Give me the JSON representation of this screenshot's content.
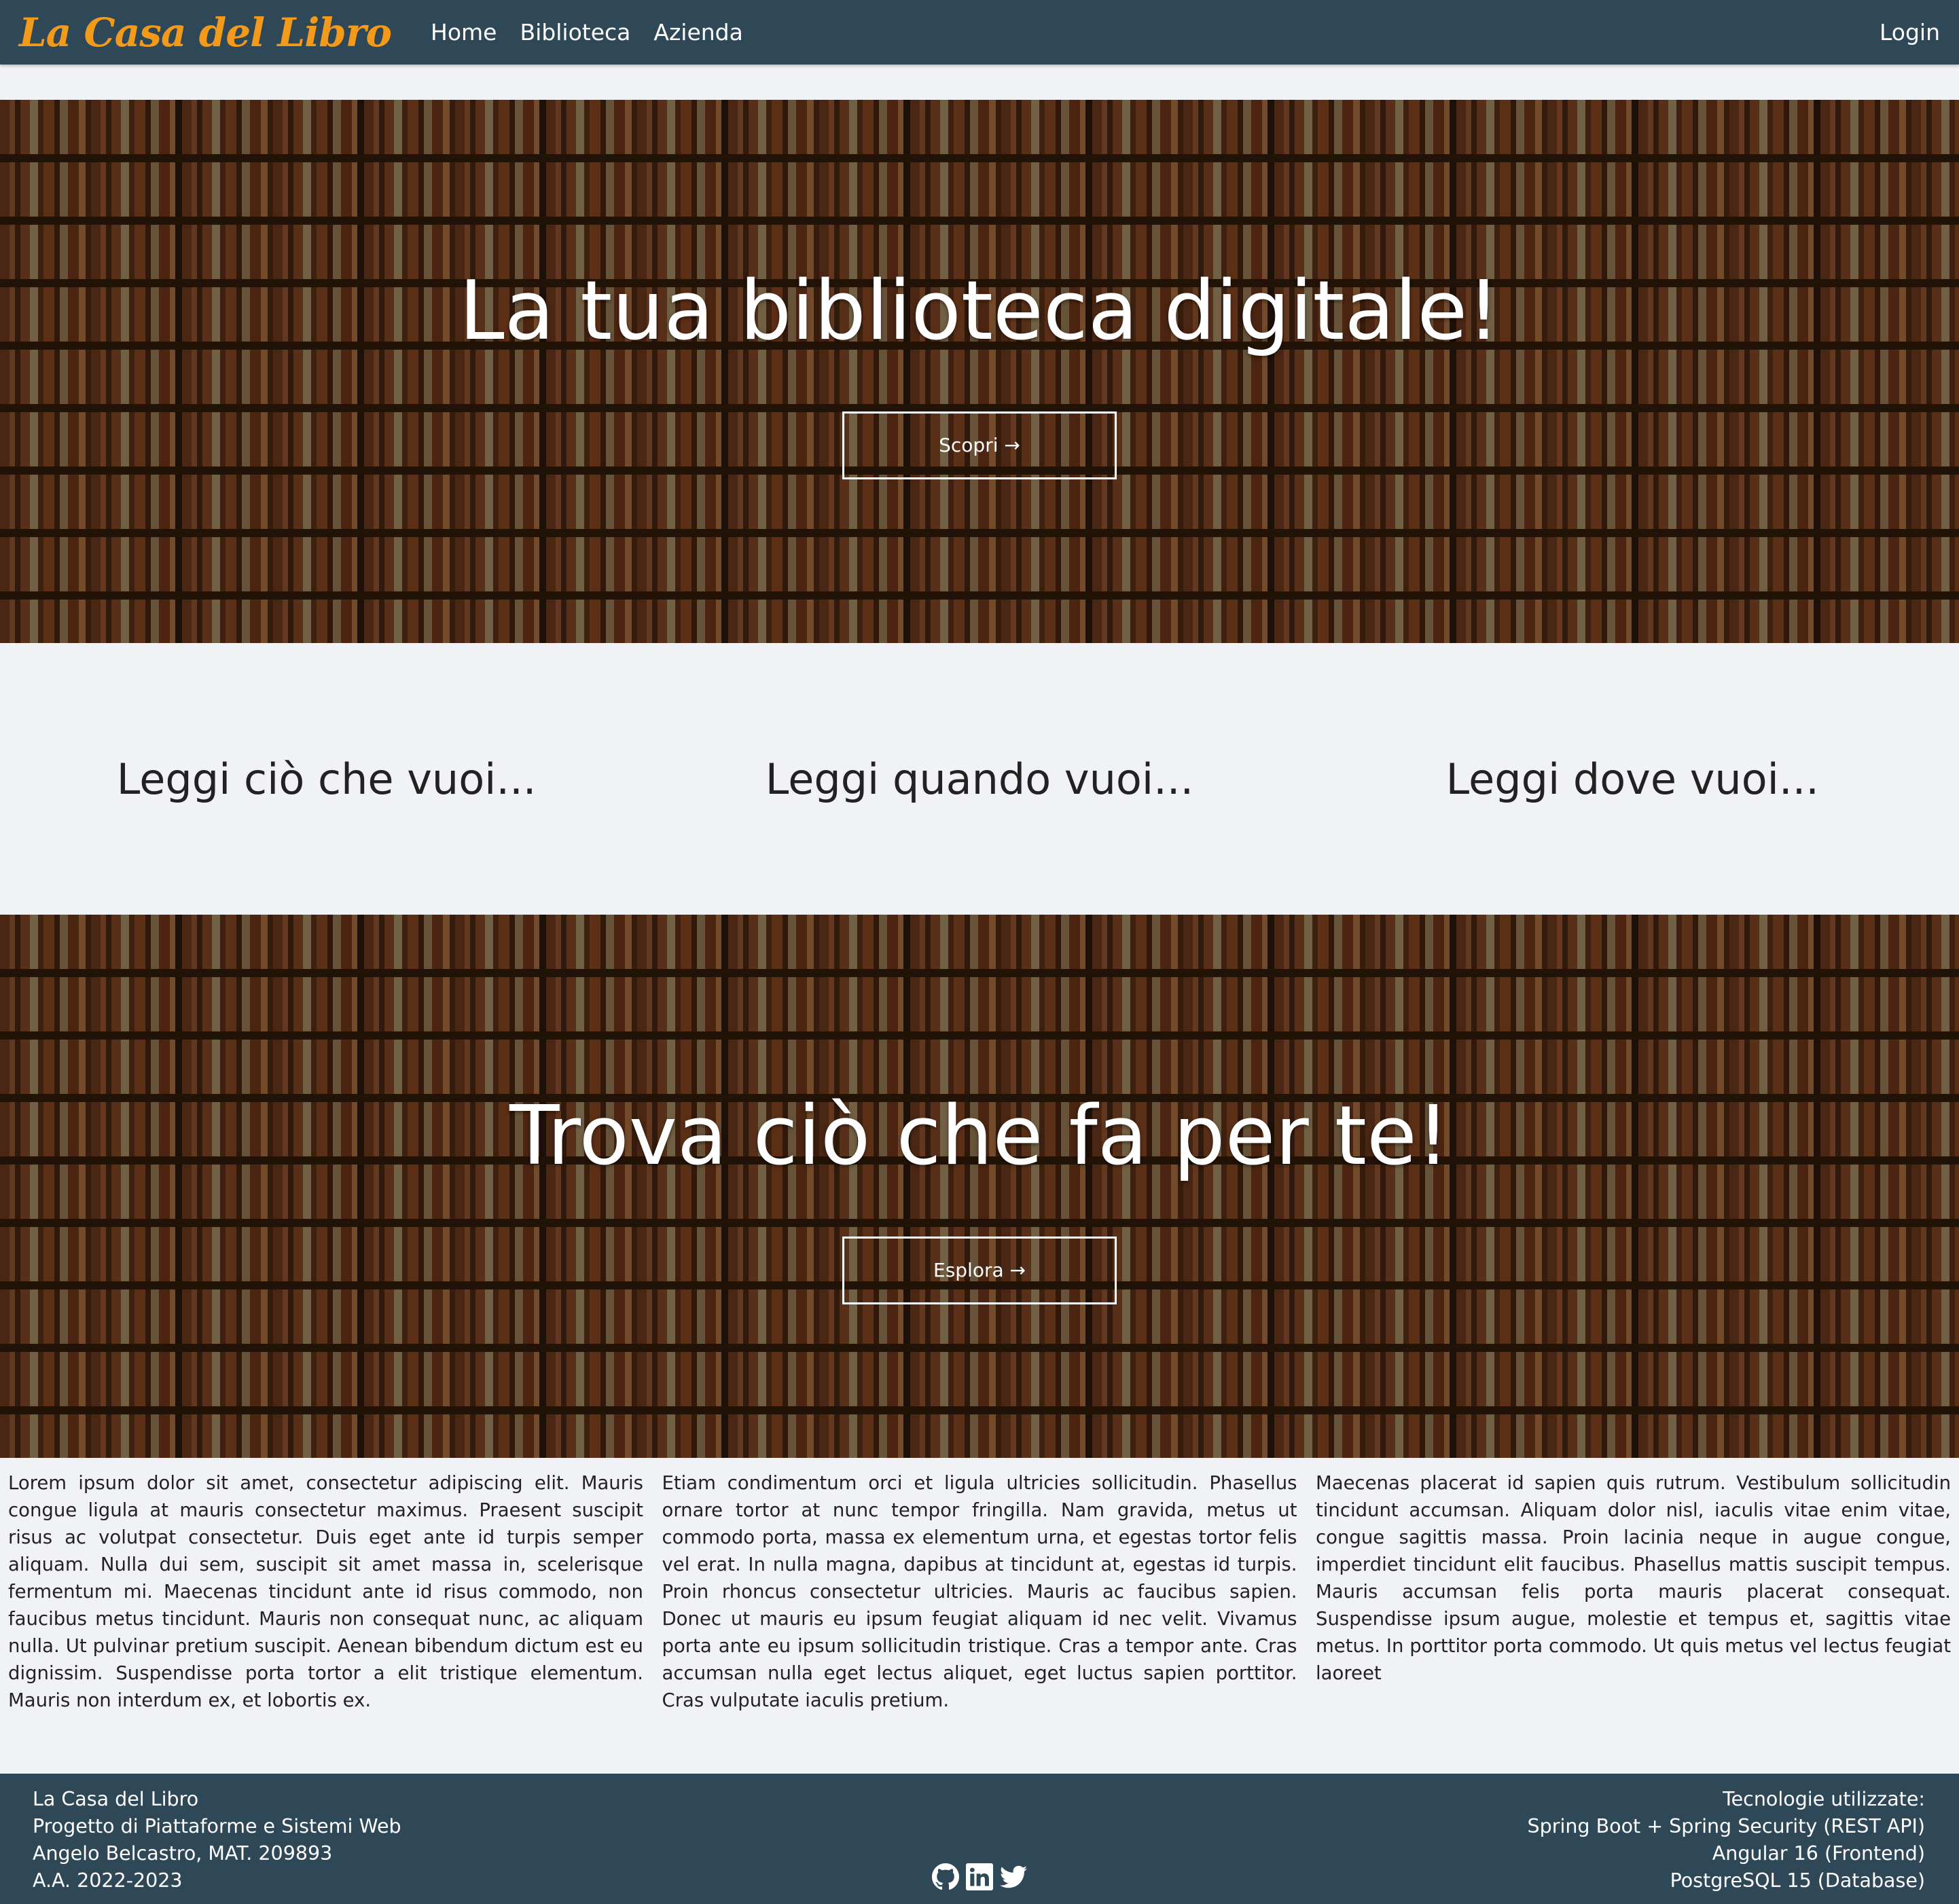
{
  "navbar": {
    "brand": "La Casa del Libro",
    "links": [
      "Home",
      "Biblioteca",
      "Azienda"
    ],
    "login": "Login"
  },
  "hero1": {
    "title": "La tua biblioteca digitale!",
    "button": "Scopri →"
  },
  "taglines": [
    "Leggi ciò che vuoi...",
    "Leggi quando vuoi...",
    "Leggi dove vuoi..."
  ],
  "hero2": {
    "title": "Trova ciò che fa per te!",
    "button": "Esplora →"
  },
  "columns": [
    "Lorem ipsum dolor sit amet, consectetur adipiscing elit. Mauris congue ligula at mauris consectetur maximus. Praesent suscipit risus ac volutpat consectetur. Duis eget ante id turpis semper aliquam. Nulla dui sem, suscipit sit amet massa in, scelerisque fermentum mi. Maecenas tincidunt ante id risus commodo, non faucibus metus tincidunt. Mauris non consequat nunc, ac aliquam nulla. Ut pulvinar pretium suscipit. Aenean bibendum dictum est eu dignissim. Suspendisse porta tortor a elit tristique elementum. Mauris non interdum ex, et lobortis ex.",
    "Etiam condimentum orci et ligula ultricies sollicitudin. Phasellus ornare tortor at nunc tempor fringilla. Nam gravida, metus ut commodo porta, massa ex elementum urna, et egestas tortor felis vel erat. In nulla magna, dapibus at tincidunt at, egestas id turpis. Proin rhoncus consectetur ultricies. Mauris ac faucibus sapien. Donec ut mauris eu ipsum feugiat aliquam id nec velit. Vivamus porta ante eu ipsum sollicitudin tristique. Cras a tempor ante. Cras accumsan nulla eget lectus aliquet, eget luctus sapien porttitor. Cras vulputate iaculis pretium.",
    "Maecenas placerat id sapien quis rutrum. Vestibulum sollicitudin tincidunt accumsan. Aliquam dolor nisl, iaculis vitae enim vitae, congue sagittis massa. Proin lacinia neque in augue congue, imperdiet tincidunt elit faucibus. Phasellus mattis suscipit tempus. Mauris accumsan felis porta mauris placerat consequat. Suspendisse ipsum augue, molestie et tempus et, sagittis vitae metus. In porttitor porta commodo. Ut quis metus vel lectus feugiat laoreet"
  ],
  "footer": {
    "left": [
      "La Casa del Libro",
      "Progetto di Piattaforme e Sistemi Web",
      "Angelo Belcastro, MAT. 209893",
      "A.A. 2022-2023"
    ],
    "right": [
      "Tecnologie utilizzate:",
      "Spring Boot + Spring Security (REST API)",
      "Angular 16 (Frontend)",
      "PostgreSQL 15 (Database)"
    ],
    "socials": [
      "github-icon",
      "linkedin-icon",
      "twitter-icon"
    ]
  },
  "colors": {
    "navbar": "#2f4858",
    "brand": "#f39a1b",
    "background": "#f1f2f6"
  }
}
